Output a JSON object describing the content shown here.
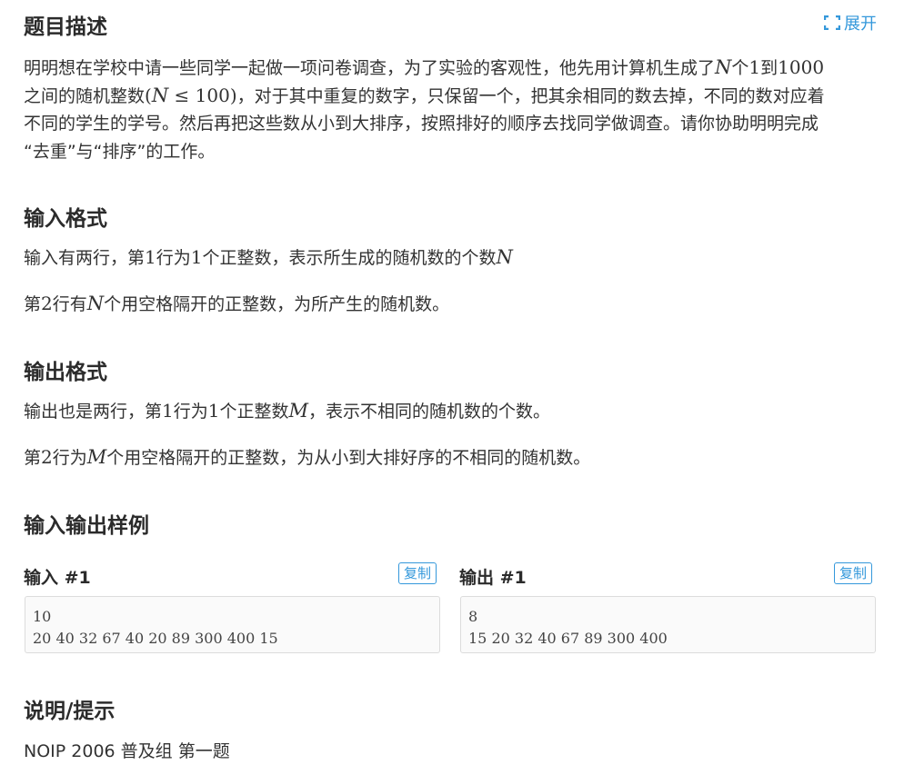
{
  "header": {
    "title": "题目描述",
    "expand_label": "展开"
  },
  "description": {
    "line1_a": "明明想在学校中请一些同学一起做一项问卷调查，为了实验的客观性，他先用计算机生成了",
    "line1_n": "N",
    "line1_b": "个",
    "line1_one": "1",
    "line1_c": "到",
    "line1_1000": "1000",
    "line2_a": "之间的随机整数",
    "line2_math_a": "(",
    "line2_math_n": "N",
    "line2_math_b": " ≤ 100)",
    "line2_b": "，对于其中重复的数字，只保留一个，把其余相同的数去掉，不同的数对应着",
    "line3": "不同的学生的学号。然后再把这些数从小到大排序，按照排好的顺序去找同学做调查。请你协助明明完成",
    "line4": "“去重”与“排序”的工作。"
  },
  "input_format": {
    "title": "输入格式",
    "p1_a": "输入有两行，第",
    "p1_one": "1",
    "p1_b": "行为",
    "p1_one2": "1",
    "p1_c": "个正整数，表示所生成的随机数的个数",
    "p1_n": "N",
    "p2_a": "第",
    "p2_two": "2",
    "p2_b": "行有",
    "p2_n": "N",
    "p2_c": "个用空格隔开的正整数，为所产生的随机数。"
  },
  "output_format": {
    "title": "输出格式",
    "p1_a": "输出也是两行，第",
    "p1_one": "1",
    "p1_b": "行为",
    "p1_one2": "1",
    "p1_c": "个正整数",
    "p1_m": "M",
    "p1_d": "，表示不相同的随机数的个数。",
    "p2_a": "第",
    "p2_two": "2",
    "p2_b": "行为",
    "p2_m": "M",
    "p2_c": "个用空格隔开的正整数，为从小到大排好序的不相同的随机数。"
  },
  "samples": {
    "title": "输入输出样例",
    "input_label": "输入 #1",
    "output_label": "输出 #1",
    "copy_label": "复制",
    "input_text": "10\n20 40 32 67 40 20 89 300 400 15",
    "output_text": "8\n15 20 32 40 67 89 300 400"
  },
  "hint": {
    "title": "说明/提示",
    "text": "NOIP 2006 普及组 第一题"
  },
  "colors": {
    "accent": "#3498db",
    "text": "#333333",
    "sample_bg": "#fafafa"
  }
}
